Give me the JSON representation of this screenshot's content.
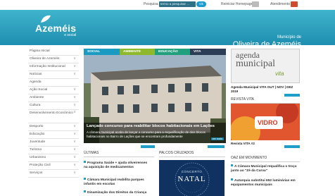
{
  "topbar": {
    "search_label": "Pesquisa",
    "search_placeholder": "termo a pesquisar ...",
    "ok_label": "Ok",
    "homepage_label": "Reiniciar Homepage",
    "atendimento_label": "Atendimento"
  },
  "header": {
    "logo_name": "Azeméis",
    "logo_sub": "e social",
    "municipio_line1": "Município de",
    "municipio_line2": "Oliveira de Azeméis"
  },
  "sidebar": {
    "items": [
      {
        "label": "Página Inicial"
      },
      {
        "label": "Oliveira de Azeméis"
      },
      {
        "label": "Informação Institucional"
      },
      {
        "label": "Notícias"
      },
      {
        "label": "Agenda"
      },
      {
        "label": "Ação Social"
      },
      {
        "label": "Ambiente"
      },
      {
        "label": "Cultura"
      },
      {
        "label": "Desenvolvimento Económico"
      },
      {
        "label": "Desporto"
      },
      {
        "label": "Educação"
      },
      {
        "label": "Juventude"
      },
      {
        "label": "Turismo"
      },
      {
        "label": "Urbanismo"
      },
      {
        "label": "Proteção Civil"
      },
      {
        "label": "Serviços"
      }
    ]
  },
  "tabs": [
    {
      "label": "SOCIAL",
      "color": "#1b9bc2"
    },
    {
      "label": "AMBIENTE",
      "color": "#8fb92d"
    },
    {
      "label": "EDUCAÇÃO",
      "color": "#21a07d"
    },
    {
      "label": "VITA",
      "color": "#2c3d56"
    }
  ],
  "featured": {
    "title": "Lançado concurso para reabilitar blocos habitacionais em Lações",
    "text": "A câmara municipal acaba de lançar o concurso para a requalificação de dois blocos habitacionais no Bairro de Lações que se encontram profundamente",
    "more_label": "ver mais"
  },
  "ultimas": {
    "heading": "ÚLTIMAS",
    "items": [
      {
        "text": "Programa Saúde + ajuda oliveirenses na aquisição de medicamentos"
      },
      {
        "text": "Câmara Municipal reabilita parques infantis em escolas"
      },
      {
        "text": "Dinamização dos Direitos da Criança"
      }
    ]
  },
  "palcos": {
    "heading": "PALCOS CRUZADOS",
    "poster_top": "CONCERTO",
    "poster_main": "NATAL"
  },
  "agenda": {
    "img_line1": "agenda",
    "img_line2": "municipal",
    "img_line3": "vita",
    "caption": "Agenda Municipal VITA OUT | NOV | DEZ 2019"
  },
  "revista": {
    "heading": "REVISTA VITA",
    "img_text": "VIDRO",
    "caption": "Revista VITA #2"
  },
  "oaz": {
    "heading": "OAZ EM MOVIMENTO",
    "items": [
      {
        "text": "A Câmara Municipal requalifica o troço junto ao \"Zé da Curva\""
      },
      {
        "text": "Autarquia substitui 652 luminárias em equipamentos municipais"
      }
    ]
  },
  "colors": {
    "header_top": "#3fb4cc",
    "header_bottom": "#1f8eb0",
    "accent": "#1f9fc7"
  }
}
